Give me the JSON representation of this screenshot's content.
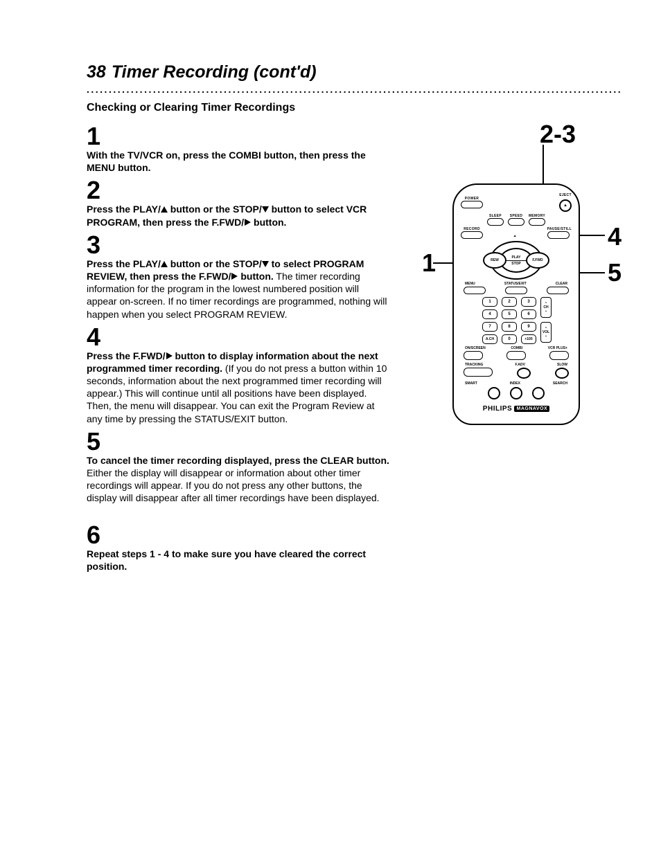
{
  "header": {
    "page_number": "38",
    "title": "Timer Recording (cont'd)",
    "subtitle": "Checking or Clearing Timer Recordings"
  },
  "steps": {
    "s1": {
      "num": "1",
      "bold": "With the TV/VCR on, press the COMBI button, then press the MENU button."
    },
    "s2": {
      "num": "2",
      "bold_a": "Press the PLAY/",
      "bold_b": " button or the STOP/",
      "bold_c": " button to select VCR PROGRAM, then press the F.FWD/",
      "bold_d": " button."
    },
    "s3": {
      "num": "3",
      "bold_a": "Press the PLAY/",
      "bold_b": " button or the STOP/",
      "bold_c": " to select PROGRAM REVIEW, then press the F.FWD/",
      "bold_d": " button.",
      "rest": " The timer recording information for the program in the lowest numbered position will appear on-screen. If no timer recordings are programmed, nothing will happen when you select PROGRAM REVIEW."
    },
    "s4": {
      "num": "4",
      "bold_a": "Press the F.FWD/",
      "bold_b": " button to display information about the next programmed timer recording.",
      "rest": " (If you do not press a button within 10 seconds, information about the next programmed timer recording will appear.) This will continue until all positions have been displayed. Then, the menu will disappear. You can exit the Program Review at any time by pressing the STATUS/EXIT button."
    },
    "s5": {
      "num": "5",
      "bold": "To cancel the timer recording displayed, press the CLEAR button.",
      "rest": " Either the display will disappear or information about other timer recordings will appear. If you do not press any other buttons, the display will disappear after all timer recordings have been displayed."
    },
    "s6": {
      "num": "6",
      "bold": "Repeat steps 1 - 4 to make sure you have cleared the correct position."
    }
  },
  "remote": {
    "callout_23": "2-3",
    "callout_4": "4",
    "callout_1": "1",
    "callout_5": "5",
    "labels": {
      "power": "POWER",
      "eject": "EJECT",
      "sleep": "SLEEP",
      "speed": "SPEED",
      "memory": "MEMORY",
      "record": "RECORD",
      "pausestill": "PAUSE/STILL",
      "play": "PLAY",
      "rew": "REW",
      "ffwd": "F.FWD",
      "stop": "STOP",
      "menu": "MENU",
      "statusexit": "STATUS/EXIT",
      "clear": "CLEAR",
      "ch": "CH",
      "vol": "VOL",
      "k1": "1",
      "k2": "2",
      "k3": "3",
      "k4": "4",
      "k5": "5",
      "k6": "6",
      "k7": "7",
      "k8": "8",
      "k9": "9",
      "k0": "0",
      "ach": "A.CH",
      "p100": "+100",
      "onscreen": "ON/SCREEN",
      "combi": "COMBI",
      "vcrplus": "VCR PLUS+",
      "tracking": "TRACKING",
      "fadv": "F.ADV",
      "slow": "SLOW",
      "smart": "SMART",
      "index": "INDEX",
      "search": "SEARCH",
      "brand": "PHILIPS",
      "brand2": "MAGNAVOX"
    }
  }
}
